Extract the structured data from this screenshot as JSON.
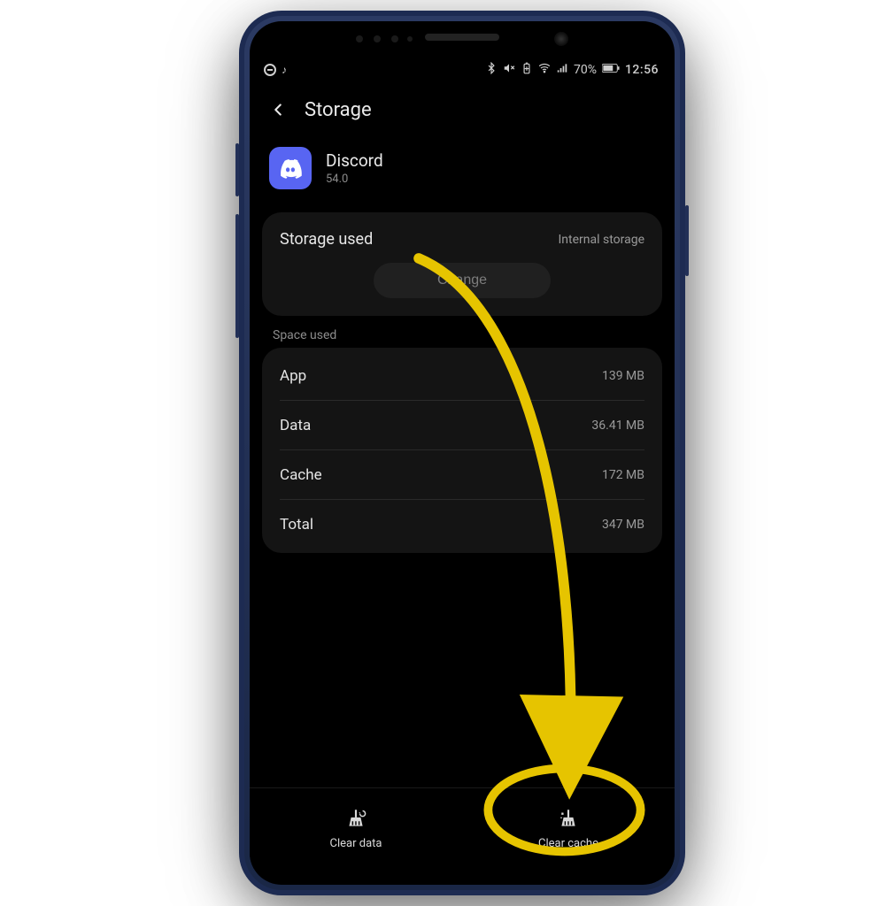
{
  "statusbar": {
    "battery_text": "70%",
    "time": "12:56"
  },
  "header": {
    "title": "Storage"
  },
  "app": {
    "name": "Discord",
    "version": "54.0",
    "icon_bg": "#5865f2"
  },
  "storage_card": {
    "title": "Storage used",
    "location": "Internal storage",
    "change_label": "Change"
  },
  "space_section_label": "Space used",
  "space_used": [
    {
      "label": "App",
      "value": "139 MB"
    },
    {
      "label": "Data",
      "value": "36.41 MB"
    },
    {
      "label": "Cache",
      "value": "172 MB"
    },
    {
      "label": "Total",
      "value": "347 MB"
    }
  ],
  "actions": {
    "clear_data": "Clear data",
    "clear_cache": "Clear cache"
  },
  "annotation": {
    "color": "#e6c400"
  }
}
